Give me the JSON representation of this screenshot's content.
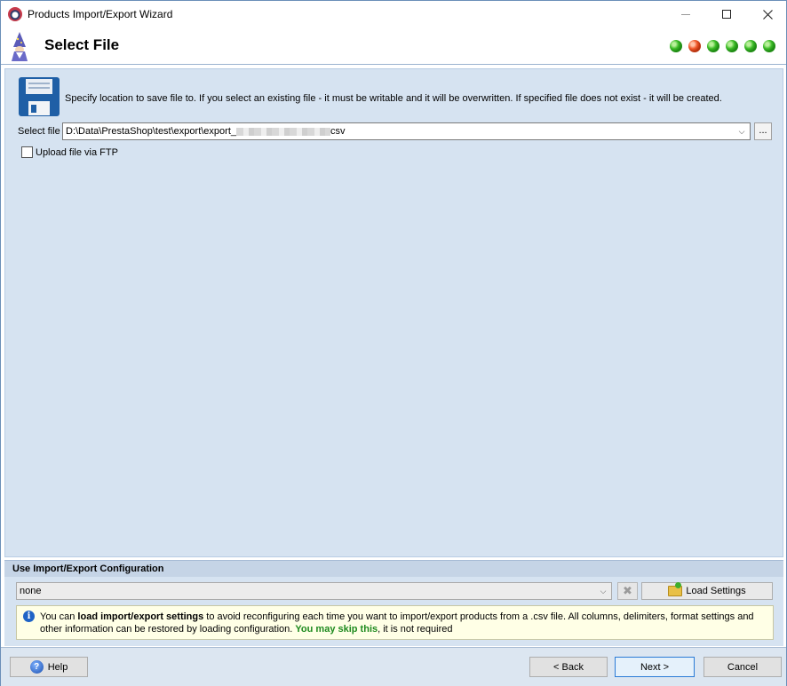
{
  "window": {
    "title": "Products Import/Export Wizard",
    "minimize_icon": "minimize-icon",
    "maximize_icon": "maximize-icon",
    "close_icon": "close-icon"
  },
  "header": {
    "title": "Select File",
    "wizard_icon": "wizard-icon",
    "steps": [
      {
        "state": "done"
      },
      {
        "state": "current"
      },
      {
        "state": "done"
      },
      {
        "state": "done"
      },
      {
        "state": "done"
      },
      {
        "state": "done"
      }
    ],
    "colors": {
      "done": "#3cbb27",
      "current": "#f0582a"
    }
  },
  "file_section": {
    "description": "Specify location to save file to. If you select an existing file - it must be writable and it will be overwritten. If specified file does not exist - it will be created.",
    "select_label": "Select file",
    "file_path_prefix": "D:\\Data\\PrestaShop\\test\\export\\export_",
    "file_path_suffix": "csv",
    "browse_label": "...",
    "ftp_label": "Upload file via FTP",
    "ftp_checked": false
  },
  "config": {
    "title": "Use Import/Export Configuration",
    "selected": "none",
    "load_label": "Load Settings",
    "info": {
      "t1": "You can ",
      "b1": "load import/export settings",
      "t2": " to avoid reconfiguring each time you want to import/export products from a .csv file. All columns, delimiters, format settings and",
      "t3": "other information can be restored by loading configuration. ",
      "g1": "You may skip this",
      "t4": ", it is not required"
    }
  },
  "footer": {
    "help_label": "Help",
    "back_label": "< Back",
    "next_label": "Next >",
    "cancel_label": "Cancel"
  }
}
